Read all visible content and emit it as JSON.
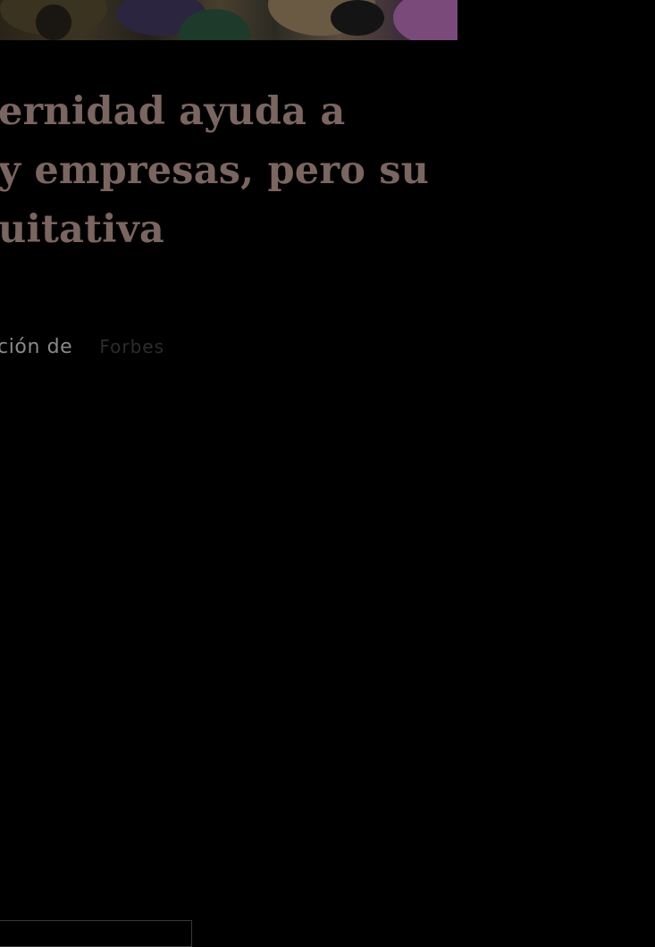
{
  "article": {
    "headline_lines": [
      "ernidad ayuda a",
      " y empresas, pero su",
      "uitativa"
    ],
    "byline_prefix": "ción de",
    "source": "Forbes"
  },
  "colors": {
    "background": "#000000",
    "headline": "#7a6560",
    "byline": "#8a8a8a",
    "source": "#2c2c2c"
  }
}
